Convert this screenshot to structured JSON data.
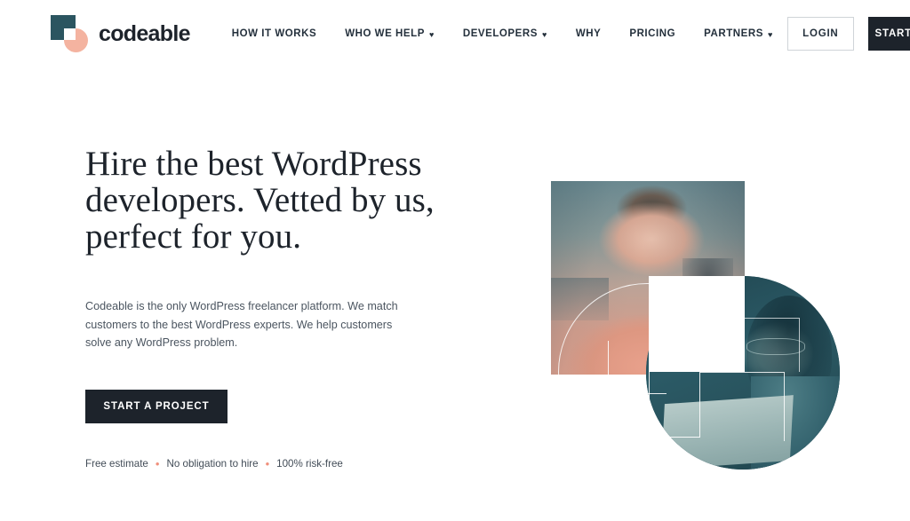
{
  "header": {
    "brand": {
      "name": "codeable",
      "logo_icon": "codeable-logo-icon",
      "square_color": "#2b5560",
      "circle_color": "#f4b3a0"
    },
    "nav": [
      {
        "label": "HOW IT WORKS",
        "has_dropdown": false,
        "caret": ""
      },
      {
        "label": "WHO WE HELP",
        "has_dropdown": true,
        "caret": "♥"
      },
      {
        "label": "DEVELOPERS",
        "has_dropdown": true,
        "caret": "♥"
      },
      {
        "label": "WHY",
        "has_dropdown": false,
        "caret": ""
      },
      {
        "label": "PRICING",
        "has_dropdown": false,
        "caret": ""
      },
      {
        "label": "PARTNERS",
        "has_dropdown": true,
        "caret": "♥"
      }
    ],
    "login_label": "LOGIN",
    "start_project_label": "START A PROJECT"
  },
  "hero": {
    "headline": "Hire the best WordPress developers. Vetted by us, perfect for you.",
    "paragraph": "Codeable is the only WordPress freelancer platform. We match customers to the best WordPress experts. We help customers solve any WordPress problem.",
    "cta_label": "START A PROJECT",
    "features": [
      "Free estimate",
      "No obligation to hire",
      "100% risk-free"
    ],
    "feature_separator": "•",
    "feature_separator_color": "#f0907c",
    "art": {
      "square_photo_alt": "smiling-man-in-office-photo",
      "circle_photo_alt": "smiling-woman-with-laptop-photo",
      "square_tint": "#d09b8e",
      "circle_tint": "#2c5a66"
    }
  },
  "colors": {
    "dark": "#1d232b",
    "text": "#24303c",
    "muted": "#4b5560",
    "accent": "#f0907c",
    "teal": "#2b5560"
  }
}
